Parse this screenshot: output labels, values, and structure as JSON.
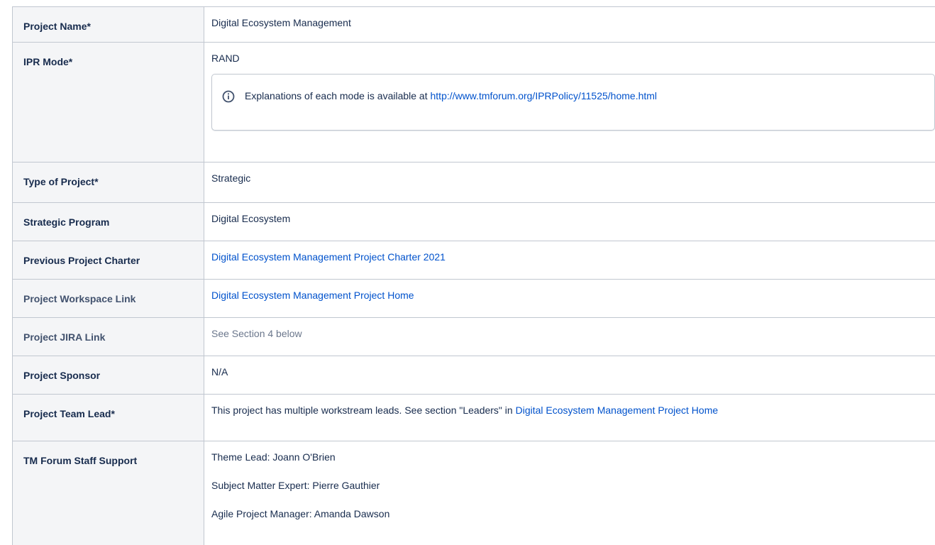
{
  "rows": [
    {
      "key": "Project Name*",
      "value": "Digital Ecosystem Management"
    },
    {
      "key": "IPR Mode*",
      "value": "RAND",
      "info": {
        "text": "Explanations of each mode is available at ",
        "link": "http://www.tmforum.org/IPRPolicy/11525/home.html"
      }
    },
    {
      "key": "Type of Project*",
      "value": "Strategic"
    },
    {
      "key": "Strategic Program",
      "value": "Digital Ecosystem"
    },
    {
      "key": "Previous Project Charter",
      "link": "Digital Ecosystem Management Project Charter 2021"
    },
    {
      "key": "Project Workspace Link",
      "link": "Digital Ecosystem Management Project Home"
    },
    {
      "key": "Project JIRA Link",
      "value": "See Section 4 below"
    },
    {
      "key": "Project Sponsor",
      "value": "N/A"
    },
    {
      "key": "Project Team Lead*",
      "value": "This project has multiple workstream leads. See section \"Leaders\" in ",
      "link": "Digital Ecosystem Management Project Home"
    },
    {
      "key": "TM Forum Staff Support",
      "lines": [
        "Theme Lead: Joann O'Brien",
        "Subject Matter Expert: Pierre Gauthier",
        "Agile Project Manager: Amanda Dawson"
      ]
    }
  ],
  "colors": {
    "link": "#0052cc",
    "key_bg": "#f4f5f7",
    "border": "#c1c7d0"
  },
  "icons": {
    "info": "info-circle-icon"
  }
}
